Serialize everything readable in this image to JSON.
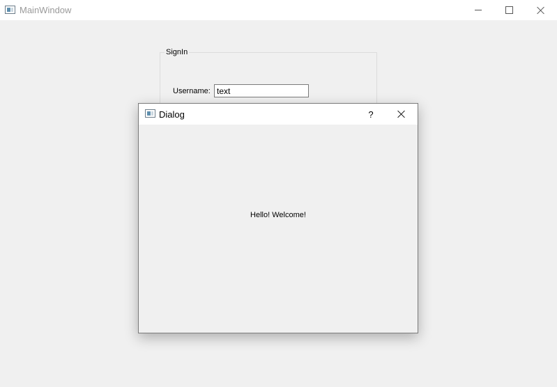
{
  "main_window": {
    "title": "MainWindow",
    "signin_group": {
      "title": "SignIn",
      "username_label": "Username:",
      "username_value": "text"
    }
  },
  "dialog": {
    "title": "Dialog",
    "help_label": "?",
    "message": "Hello! Welcome!"
  },
  "icons": {
    "app": "app-window-icon",
    "minimize": "minimize-icon",
    "maximize": "maximize-icon",
    "close": "close-icon"
  }
}
